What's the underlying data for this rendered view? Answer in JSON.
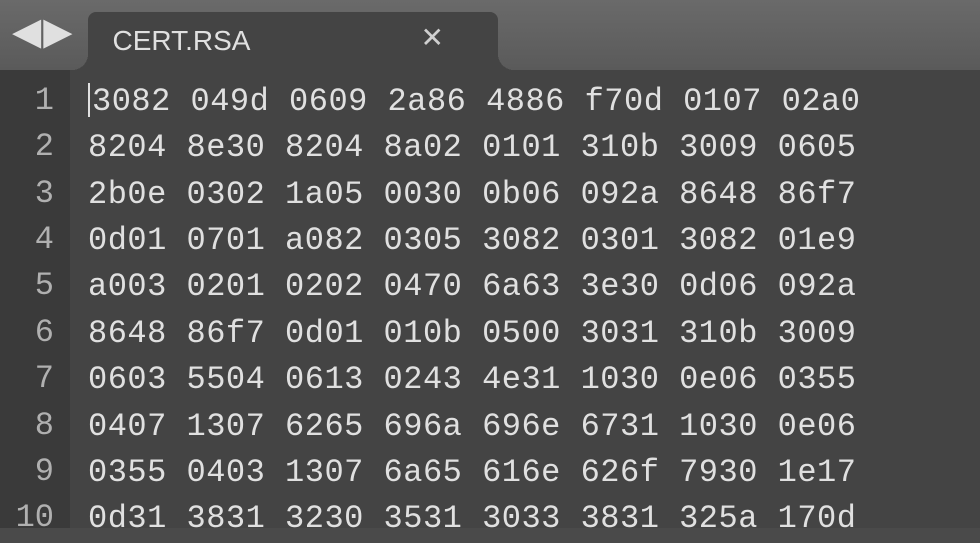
{
  "tab": {
    "title": "CERT.RSA"
  },
  "lines": [
    {
      "num": "1",
      "text": "3082 049d 0609 2a86 4886 f70d 0107 02a0"
    },
    {
      "num": "2",
      "text": "8204 8e30 8204 8a02 0101 310b 3009 0605"
    },
    {
      "num": "3",
      "text": "2b0e 0302 1a05 0030 0b06 092a 8648 86f7"
    },
    {
      "num": "4",
      "text": "0d01 0701 a082 0305 3082 0301 3082 01e9"
    },
    {
      "num": "5",
      "text": "a003 0201 0202 0470 6a63 3e30 0d06 092a"
    },
    {
      "num": "6",
      "text": "8648 86f7 0d01 010b 0500 3031 310b 3009"
    },
    {
      "num": "7",
      "text": "0603 5504 0613 0243 4e31 1030 0e06 0355"
    },
    {
      "num": "8",
      "text": "0407 1307 6265 696a 696e 6731 1030 0e06"
    },
    {
      "num": "9",
      "text": "0355 0403 1307 6a65 616e 626f 7930 1e17"
    },
    {
      "num": "10",
      "text": "0d31 3831 3230 3531 3033 3831 325a 170d"
    }
  ]
}
